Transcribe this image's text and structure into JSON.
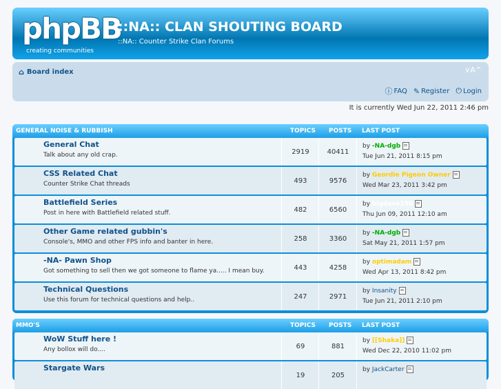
{
  "header": {
    "logo_text": "phpBB",
    "logo_tagline": "creating   communities",
    "site_title": "::NA:: CLAN SHOUTING BOARD",
    "site_description": "::NA:: Counter Strike Clan Forums"
  },
  "nav": {
    "board_index": "Board index",
    "font_size": "∨A^",
    "faq": "FAQ",
    "register": "Register",
    "login": "Login"
  },
  "current_time": "It is currently Wed Jun 22, 2011 2:46 pm",
  "sections": [
    {
      "title": "GENERAL NOISE & RUBBISH",
      "col_topics": "TOPICS",
      "col_posts": "POSTS",
      "col_last": "LAST POST",
      "forums": [
        {
          "name": "General Chat",
          "desc": "Talk about any old crap.",
          "topics": "2919",
          "posts": "40411",
          "by": "by",
          "user": "-NA-dgb",
          "user_color": "#00aa00",
          "when": "Tue Jun 21, 2011 8:15 pm"
        },
        {
          "name": "CSS Related Chat",
          "desc": "Counter Strike Chat threads",
          "topics": "493",
          "posts": "9576",
          "by": "by",
          "user": "Geordie Pigeon Owner",
          "user_color": "#ffcc00",
          "when": "Wed Mar 23, 2011 3:42 pm"
        },
        {
          "name": "Battlefield Series",
          "desc": "Post in here with Battlefield related stuff.",
          "topics": "482",
          "posts": "6560",
          "by": "by",
          "user": "bigdave190",
          "user_color": "#ffffff",
          "when": "Thu Jun 09, 2011 12:10 am"
        },
        {
          "name": "Other Game related gubbin's",
          "desc": "Console's, MMO and other FPS info and banter in here.",
          "topics": "258",
          "posts": "3360",
          "by": "by",
          "user": "-NA-dgb",
          "user_color": "#00aa00",
          "when": "Sat May 21, 2011 1:57 pm"
        },
        {
          "name": "-NA- Pawn Shop",
          "desc": "Got something to sell then we got someone to flame ya..... I mean buy.",
          "topics": "443",
          "posts": "4258",
          "by": "by",
          "user": "optimadam",
          "user_color": "#ffcc00",
          "when": "Wed Apr 13, 2011 8:42 pm"
        },
        {
          "name": "Technical Questions",
          "desc": "Use this forum for technical questions and help..",
          "topics": "247",
          "posts": "2971",
          "by": "by",
          "user": "Insanity",
          "user_color": "#105289",
          "when": "Tue Jun 21, 2011 2:10 pm"
        }
      ]
    },
    {
      "title": "MMO'S",
      "col_topics": "TOPICS",
      "col_posts": "POSTS",
      "col_last": "LAST POST",
      "forums": [
        {
          "name": "WoW Stuff here !",
          "desc": "Any bollox will do....",
          "topics": "69",
          "posts": "881",
          "by": "by",
          "user": "[[Shaka]]",
          "user_color": "#ffcc00",
          "when": "Wed Dec 22, 2010 11:02 pm"
        },
        {
          "name": "Stargate Wars",
          "desc": "",
          "topics": "19",
          "posts": "205",
          "by": "by",
          "user": "JackCarter",
          "user_color": "#105289",
          "when": ""
        }
      ]
    }
  ]
}
